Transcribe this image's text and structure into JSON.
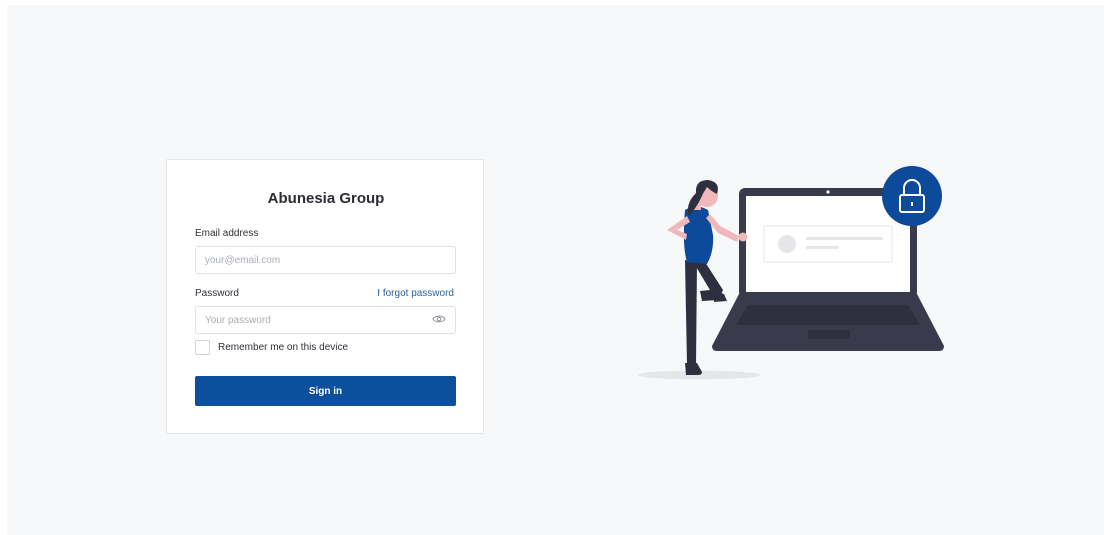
{
  "app": {
    "title": "Abunesia Group"
  },
  "form": {
    "email_label": "Email address",
    "email_placeholder": "your@email.com",
    "email_value": "",
    "password_label": "Password",
    "forgot_password": "I forgot password",
    "password_placeholder": "Your password",
    "password_value": "",
    "remember_label": "Remember me on this device",
    "remember_checked": false,
    "submit_label": "Sign in"
  },
  "icons": {
    "password_toggle": "eye-icon",
    "illustration_badge": "lock-icon"
  },
  "colors": {
    "primary": "#0c4f9c",
    "link": "#2c5f9e",
    "background": "#f7f8fa",
    "illustration_accent": "#0d4a99",
    "illustration_dark": "#3a3a4d"
  }
}
